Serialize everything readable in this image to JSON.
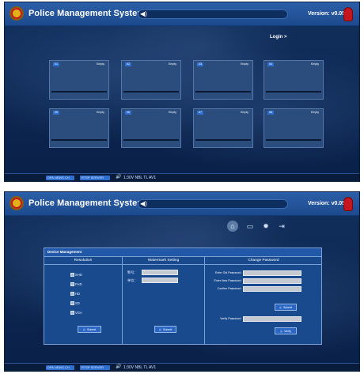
{
  "app": {
    "title": "Police Management System",
    "version": "Version: v0.05"
  },
  "status_bar": {
    "chip1": "DPA NEWS CH",
    "chip2": "RTSP SERVER",
    "vol_glyph": "🔊",
    "text": "1:30V NBL TL AV1"
  },
  "screen1": {
    "login_label": "Login >",
    "tiles": [
      {
        "num": "01",
        "state": "Empty"
      },
      {
        "num": "02",
        "state": "Empty"
      },
      {
        "num": "03",
        "state": "Empty"
      },
      {
        "num": "04",
        "state": "Empty"
      },
      {
        "num": "05",
        "state": "Empty"
      },
      {
        "num": "06",
        "state": "Empty"
      },
      {
        "num": "07",
        "state": "Empty"
      },
      {
        "num": "08",
        "state": "Empty"
      }
    ]
  },
  "screen2": {
    "nav_icons": [
      "home-icon",
      "monitor-icon",
      "gear-icon",
      "logout-icon"
    ],
    "nav_glyphs": [
      "⌂",
      "▭",
      "✹",
      "⇥"
    ],
    "panel_title": "Device Management",
    "resolution": {
      "header": "Resolution",
      "options": [
        "SHD",
        "FHD",
        "HD",
        "SD",
        "VGA"
      ],
      "submit": "Submit"
    },
    "watermark": {
      "header": "Watermark Setting",
      "label1": "警号：",
      "label2": "单位：",
      "submit": "Submit"
    },
    "password": {
      "header": "Change Password",
      "old_label": "Enter Old Password :",
      "new_label": "Enter New Password :",
      "confirm_label": "Confirm Password :",
      "submit": "Submit",
      "verify_label": "Verify Password :",
      "verify_btn": "Verify"
    }
  },
  "colors": {
    "accent": "#2f6fd0",
    "panel": "#1a4a8e",
    "topbar": "#2c5fa8"
  }
}
